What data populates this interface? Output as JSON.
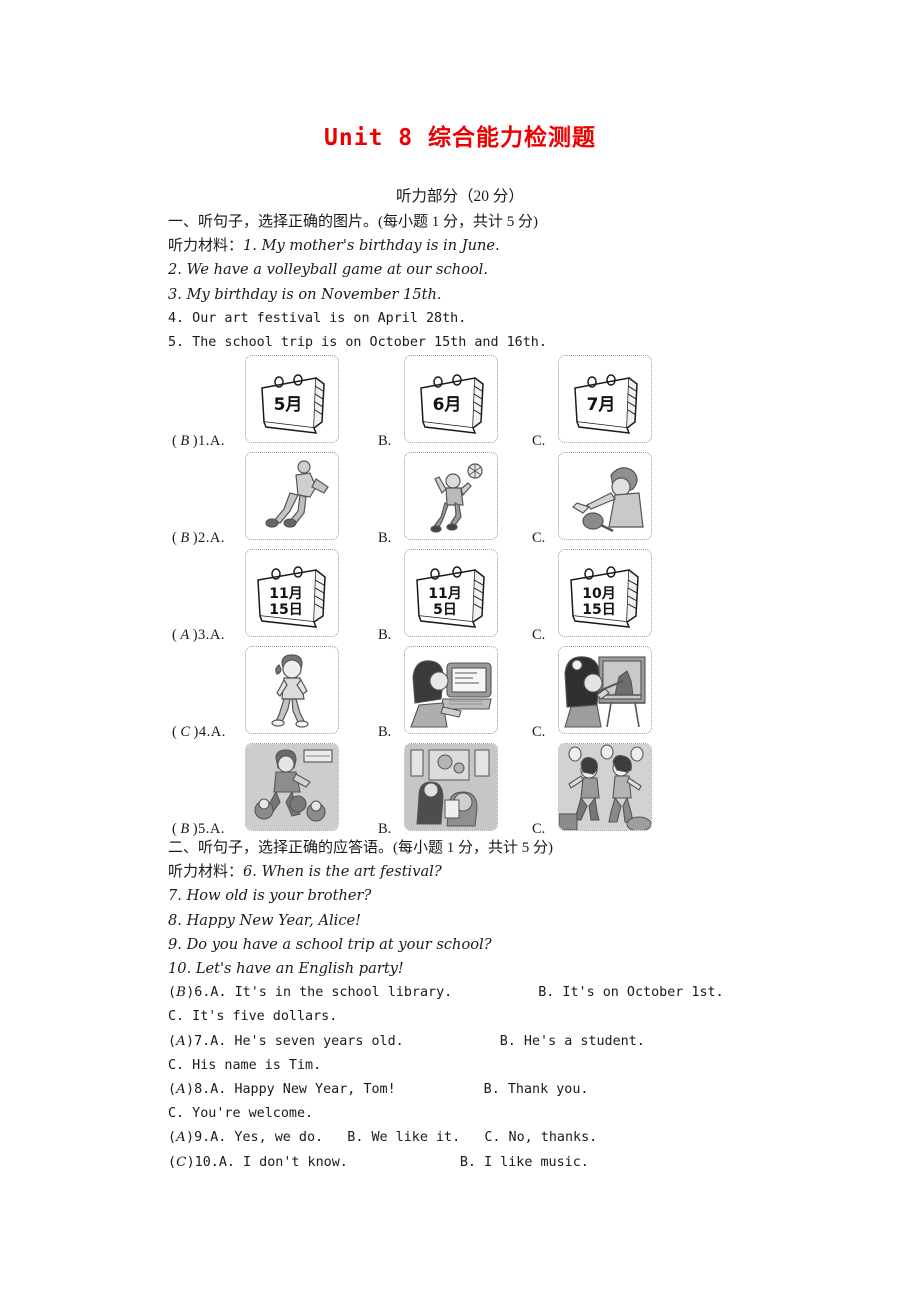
{
  "title": "Unit 8 综合能力检测题",
  "title_color": "#ee0000",
  "section_header": "听力部分（20 分）",
  "part_one": {
    "heading": "一、听句子，选择正确的图片。(每小题 1 分，共计 5 分)",
    "material_label": "听力材料：",
    "materials": [
      "1. My mother's birthday is in June.",
      "2. We have a volleyball game at our school.",
      "3. My birthday is on November 15th.",
      "4. Our art festival is on April 28th.",
      "5. The school trip is on October 15th and 16th."
    ],
    "questions": [
      {
        "answer": "B",
        "number": "1.",
        "options": [
          "A.",
          "B.",
          "C."
        ],
        "pictures": [
          "calendar-may",
          "calendar-june",
          "calendar-july"
        ],
        "picture_text": [
          "5月",
          "6月",
          "7月"
        ]
      },
      {
        "answer": "B",
        "number": "2.",
        "options": [
          "A.",
          "B.",
          "C."
        ],
        "pictures": [
          "basketball-player",
          "volleyball-player",
          "table-tennis-player"
        ],
        "picture_text": [
          "",
          "",
          ""
        ]
      },
      {
        "answer": "A",
        "number": "3.",
        "options": [
          "A.",
          "B.",
          "C."
        ],
        "pictures": [
          "calendar-nov-15",
          "calendar-nov-5",
          "calendar-oct-15"
        ],
        "picture_text": [
          "11月 15日",
          "11月 5日",
          "10月 15日"
        ]
      },
      {
        "answer": "C",
        "number": "4.",
        "options": [
          "A.",
          "B.",
          "C."
        ],
        "pictures": [
          "girl-walking",
          "girl-at-computer",
          "girl-painting"
        ],
        "picture_text": [
          "",
          "",
          ""
        ]
      },
      {
        "answer": "B",
        "number": "5.",
        "options": [
          "A.",
          "B.",
          "C."
        ],
        "pictures": [
          "kids-playing-ball",
          "classroom-scene",
          "girls-dancing"
        ],
        "picture_text": [
          "",
          "",
          ""
        ]
      }
    ]
  },
  "part_two": {
    "heading": "二、听句子，选择正确的应答语。(每小题 1 分，共计 5 分)",
    "material_label": "听力材料：",
    "materials": [
      "6. When is the art festival?",
      "7. How old is your brother?",
      "8. Happy New Year, Alice!",
      "9. Do you have a school trip at your school?",
      "10. Let's have an English party!"
    ],
    "questions": [
      {
        "answer": "B",
        "number": "6.",
        "line1": "A. It's in the school library.",
        "line1b": "B. It's on October 1st.",
        "line2": "C. It's five dollars."
      },
      {
        "answer": "A",
        "number": "7.",
        "line1": "A. He's seven years old.",
        "line1b": "B. He's a student.",
        "line2": "C. His name is Tim."
      },
      {
        "answer": "A",
        "number": "8.",
        "line1": "A. Happy New Year, Tom!",
        "line1b": "B. Thank you.",
        "line2": "C. You're welcome."
      },
      {
        "answer": "A",
        "number": "9.",
        "line1": "A. Yes, we do.   B. We like it.   C. No, thanks.",
        "line1b": "",
        "line2": ""
      },
      {
        "answer": "C",
        "number": "10.",
        "line1": "A. I don't know.",
        "line1b": "B. I like music.",
        "line2": ""
      }
    ]
  }
}
